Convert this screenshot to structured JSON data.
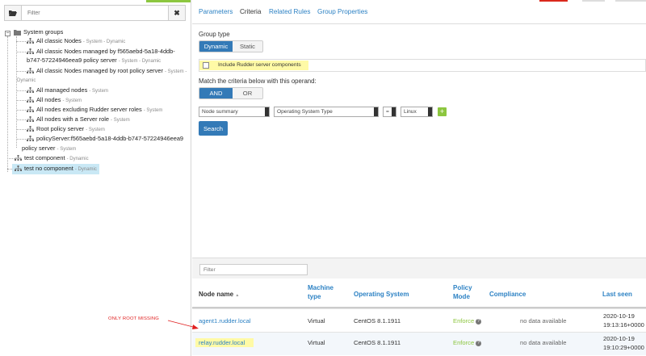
{
  "left": {
    "filter_placeholder": "Filter",
    "tree": {
      "root_label": "System groups",
      "items": [
        {
          "name": "All classic Nodes",
          "tag": "- System - Dynamic"
        },
        {
          "name": "All classic Nodes managed by f565aebd-5a18-4ddb-",
          "cont": "b747-57224946eea9 policy server",
          "tag": "- System - Dynamic"
        },
        {
          "name": "All classic Nodes managed by root policy server",
          "tag": "- System -",
          "cont_tag": "Dynamic"
        },
        {
          "name": "All managed nodes",
          "tag": "- System"
        },
        {
          "name": "All nodes",
          "tag": "- System"
        },
        {
          "name": "All nodes excluding Rudder server roles",
          "tag": "- System"
        },
        {
          "name": "All nodes with a Server role",
          "tag": "- System"
        },
        {
          "name": "Root policy server",
          "tag": "- System"
        },
        {
          "name": "policyServer:f565aebd-5a18-4ddb-b747-57224946eea9",
          "cont": "policy server",
          "tag": "- System"
        }
      ],
      "other": [
        {
          "name": "test component",
          "tag": "- Dynamic"
        },
        {
          "name": "test no component",
          "tag": "- Dynamic"
        }
      ]
    }
  },
  "tabs": [
    "Parameters",
    "Criteria",
    "Related Rules",
    "Group Properties"
  ],
  "criteria": {
    "group_type_label": "Group type",
    "group_type_options": [
      "Dynamic",
      "Static"
    ],
    "include_label": "Include Rudder server components",
    "operand_label": "Match the criteria below with this operand:",
    "operand_options": [
      "AND",
      "OR"
    ],
    "selects": {
      "object": "Node summary",
      "attribute": "Operating System Type",
      "comparator": "=",
      "value": "Linux"
    },
    "add_label": "+",
    "search_label": "Search"
  },
  "table": {
    "filter_placeholder": "Filter",
    "headers": {
      "node_name": "Node name",
      "sort_glyph": "▲",
      "machine_type": "Machine type",
      "os": "Operating System",
      "policy_mode": "Policy Mode",
      "compliance": "Compliance",
      "last_seen": "Last seen"
    },
    "rows": [
      {
        "name": "agent1.rudder.local",
        "machine": "Virtual",
        "os": "CentOS 8.1.1911",
        "mode": "Enforce",
        "compliance": "no data available",
        "last_seen_date": "2020-10-19",
        "last_seen_time": "19:13:16+0000"
      },
      {
        "name": "relay.rudder.local",
        "machine": "Virtual",
        "os": "CentOS 8.1.1911",
        "mode": "Enforce",
        "compliance": "no data available",
        "last_seen_date": "2020-10-19",
        "last_seen_time": "19:10:29+0000"
      }
    ]
  },
  "annotation": "ONLY ROOT MISSING",
  "colors": {
    "link": "#2d82c4",
    "primary": "#337ab7",
    "accent_green": "#8cc63f",
    "highlight": "#fffaa6",
    "annotation": "#e02020"
  }
}
